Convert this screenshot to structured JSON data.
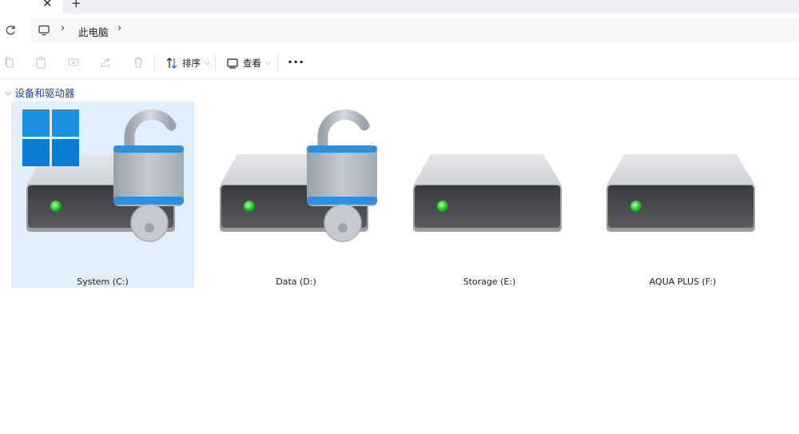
{
  "tabbar": {
    "close_glyph": "✕",
    "new_tab_glyph": "+"
  },
  "address": {
    "refresh_icon": "refresh-icon",
    "location_icon": "computer-icon",
    "breadcrumb": [
      "此电脑"
    ],
    "separator": "›"
  },
  "toolbar": {
    "sort_label": "排序",
    "view_label": "查看",
    "more_label": "···"
  },
  "section": {
    "title": "设备和驱动器"
  },
  "drives": [
    {
      "label": "System (C:)",
      "selected": true,
      "windows_logo": true,
      "lock": true
    },
    {
      "label": "Data (D:)",
      "selected": false,
      "windows_logo": false,
      "lock": true
    },
    {
      "label": "Storage (E:)",
      "selected": false,
      "windows_logo": false,
      "lock": false
    },
    {
      "label": "AQUA PLUS (F:)",
      "selected": false,
      "windows_logo": false,
      "lock": false
    }
  ],
  "colors": {
    "accent": "#0067c0",
    "selection": "#e1effd",
    "led": "#3ddc3d"
  }
}
